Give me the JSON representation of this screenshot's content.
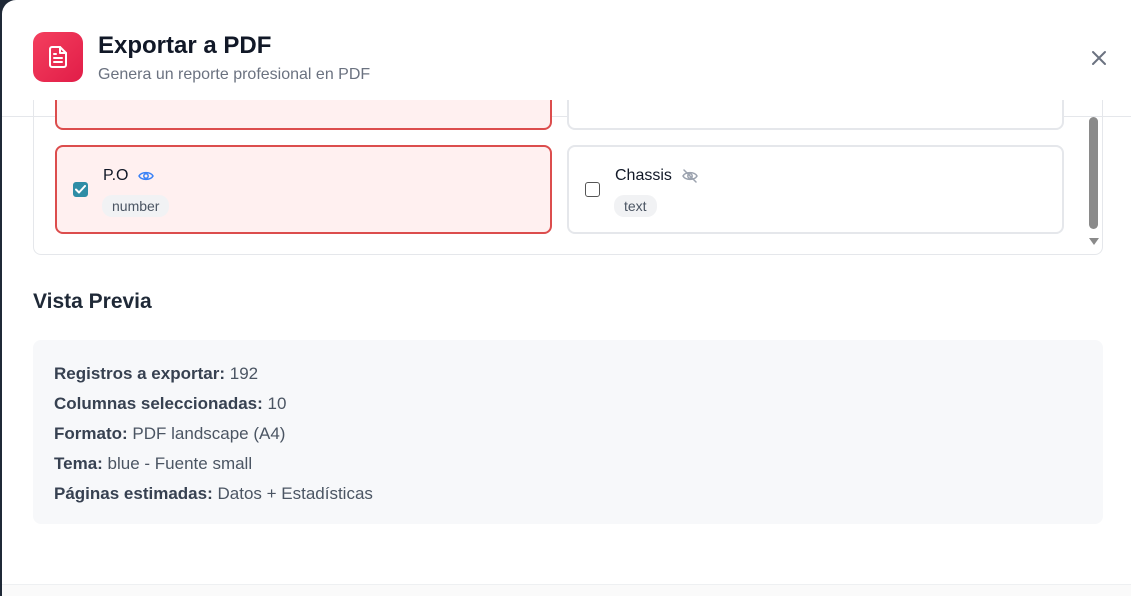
{
  "dialog": {
    "title": "Exportar a PDF",
    "subtitle": "Genera un reporte profesional en PDF",
    "icon": "file-text-icon",
    "accent_color": "#e11d48"
  },
  "columns": [
    {
      "name": "P.O",
      "type": "number",
      "selected": true,
      "visible_icon": "eye-icon"
    },
    {
      "name": "Chassis",
      "type": "text",
      "selected": false,
      "visible_icon": "eye-off-icon"
    }
  ],
  "preview": {
    "heading": "Vista Previa",
    "lines": [
      {
        "label": "Registros a exportar:",
        "value": "192"
      },
      {
        "label": "Columnas seleccionadas:",
        "value": "10"
      },
      {
        "label": "Formato:",
        "value": "PDF landscape (A4)"
      },
      {
        "label": "Tema:",
        "value": "blue - Fuente small"
      },
      {
        "label": "Páginas estimadas:",
        "value": "Datos + Estadísticas"
      }
    ]
  }
}
